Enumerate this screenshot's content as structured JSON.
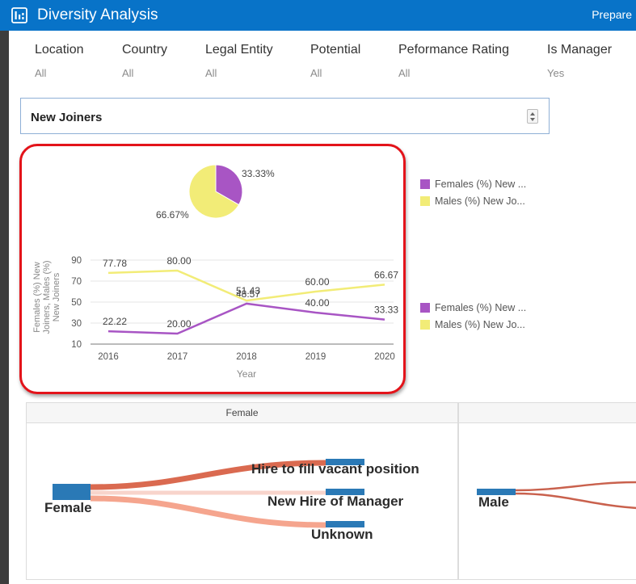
{
  "header": {
    "title": "Diversity Analysis",
    "prepare_label": "Prepare"
  },
  "filters": [
    {
      "label": "Location",
      "value": "All"
    },
    {
      "label": "Country",
      "value": "All"
    },
    {
      "label": "Legal Entity",
      "value": "All"
    },
    {
      "label": "Potential",
      "value": "All"
    },
    {
      "label": "Peformance Rating",
      "value": "All"
    },
    {
      "label": "Is Manager",
      "value": "Yes"
    }
  ],
  "selector": {
    "value": "New Joiners"
  },
  "colors": {
    "female": "#a855c4",
    "male": "#f2ec77",
    "header": "#0873c8",
    "highlight": "#e3131a",
    "node": "#2a79b6",
    "flow_strong": "#da6a50",
    "flow_light": "#f5a58e",
    "flow_faint": "#f8d4cb"
  },
  "chart_data": [
    {
      "type": "pie",
      "labels": [
        "Females (%) New ...",
        "Males (%) New Jo..."
      ],
      "values": [
        33.33,
        66.67
      ],
      "value_labels": [
        "33.33%",
        "66.67%"
      ],
      "legend_placement": "right"
    },
    {
      "type": "line",
      "x": [
        "2016",
        "2017",
        "2018",
        "2019",
        "2020"
      ],
      "series": [
        {
          "name": "Females (%) New ...",
          "values": [
            22.22,
            20.0,
            48.57,
            40.0,
            33.33
          ],
          "labels": [
            "22.22",
            "20.00",
            "48.57",
            "40.00",
            "33.33"
          ]
        },
        {
          "name": "Males (%) New Jo...",
          "values": [
            77.78,
            80.0,
            51.43,
            60.0,
            66.67
          ],
          "labels": [
            "77.78",
            "80.00",
            "51.43",
            "60.00",
            "66.67"
          ]
        }
      ],
      "xlabel": "Year",
      "ylabel": "Females (%) New Joiners, Males (%) New Joiners",
      "yticks": [
        "90",
        "70",
        "50",
        "30",
        "10"
      ],
      "ylim": [
        10,
        90
      ],
      "grid": true,
      "legend_placement": "right"
    }
  ],
  "sankey": {
    "female_panel": {
      "header": "Female",
      "source": "Female",
      "targets": [
        "Hire to fill vacant position",
        "New Hire of Manager",
        "Unknown"
      ]
    },
    "male_panel": {
      "header": "",
      "source": "Male"
    }
  }
}
